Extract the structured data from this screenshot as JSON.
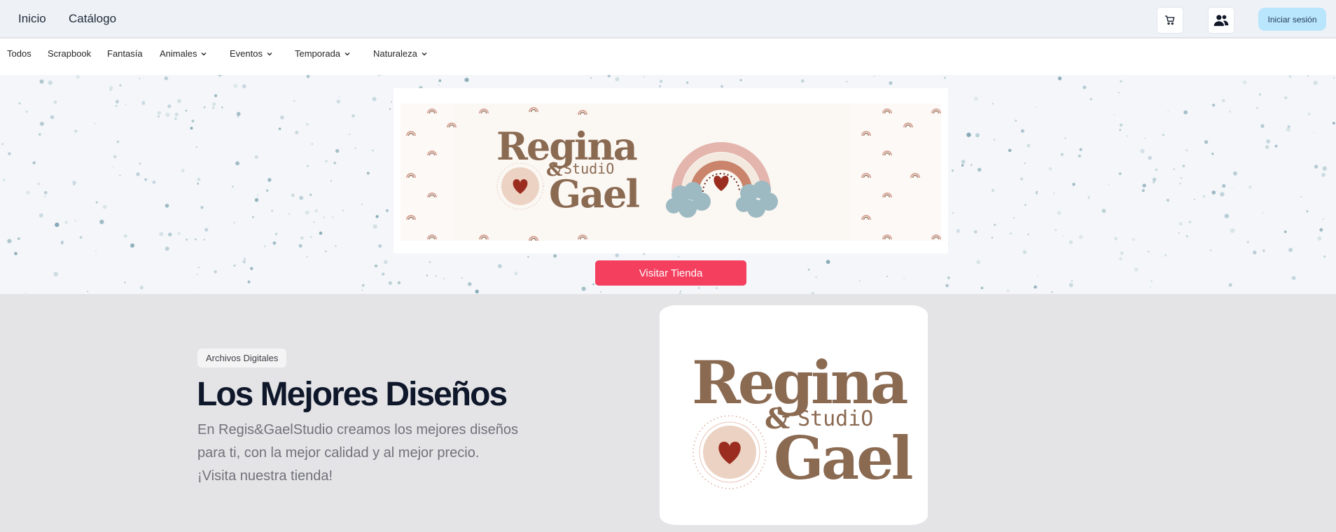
{
  "topnav": {
    "items": [
      "Inicio",
      "Catálogo"
    ],
    "cart_icon": "cart-icon",
    "users_icon": "users-icon",
    "login_label": "Iniciar sesión"
  },
  "categories": [
    {
      "label": "Todos",
      "dropdown": false
    },
    {
      "label": "Scrapbook",
      "dropdown": false
    },
    {
      "label": "Fantasía",
      "dropdown": false
    },
    {
      "label": "Animales",
      "dropdown": true
    },
    {
      "label": "Eventos",
      "dropdown": true
    },
    {
      "label": "Temporada",
      "dropdown": true
    },
    {
      "label": "Naturaleza",
      "dropdown": true
    }
  ],
  "hero": {
    "banner_logo_lines": [
      "Regina",
      "&",
      "StudiO",
      "Gael"
    ],
    "button_label": "Visitar Tienda"
  },
  "feature": {
    "badge": "Archivos Digitales",
    "title": "Los Mejores Diseños",
    "description_lines": [
      "En Regis&GaelStudio creamos los mejores diseños",
      "para ti, con la mejor calidad y al mejor precio.",
      "¡Visita nuestra tienda!"
    ],
    "logo_lines": [
      "Regina",
      "&",
      "StudiO",
      "Gael"
    ]
  },
  "colors": {
    "accent": "#f43f5e",
    "login_bg": "#bae6fd",
    "logo_brown": "#8b6a52",
    "heart_red": "#9b2d20",
    "rainbow_pink": "#e3b5ad",
    "rainbow_tan": "#c9846b",
    "cloud_blue": "#9dbac2"
  }
}
